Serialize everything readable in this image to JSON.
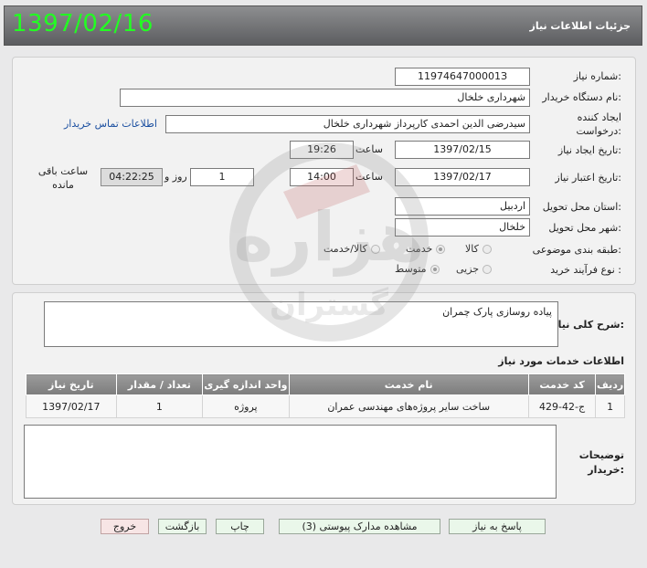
{
  "header": {
    "date": "1397/02/16",
    "title": "جزئیات اطلاعات نیاز"
  },
  "form": {
    "need_number_label": "شماره نیاز:",
    "need_number": "1197464700001З",
    "buyer_org_label": "نام دستگاه خریدار:",
    "buyer_org": "شهرداری خلخال",
    "creator_label": "ایجاد کننده درخواست:",
    "creator": "سیدرضی الدین  احمدی کارپرداز شهرداری خلخال",
    "contact_link": "اطلاعات تماس خریدار",
    "created_label": "تاریخ ایجاد نیاز:",
    "created_date": "1397/02/15",
    "time_label": "ساعت",
    "created_time": "19:26",
    "validity_label": "تاریخ اعتبار نیاز:",
    "validity_date": "1397/02/17",
    "validity_time": "14:00",
    "days": "1",
    "days_label": "روز و",
    "countdown": "04:22:25",
    "remaining_label": "ساعت باقی مانده",
    "province_label": "استان محل تحویل:",
    "province": "اردبیل",
    "city_label": "شهر محل تحویل:",
    "city": "خلخال",
    "category_label": "طبقه بندی موضوعی:",
    "category_options": [
      "کالا",
      "خدمت",
      "کالا/خدمت"
    ],
    "process_label": "نوع فرآیند خرید :",
    "process_options": [
      "جزیی",
      "متوسط"
    ]
  },
  "details": {
    "summary_label": "شرح کلی نیاز:",
    "summary": "پیاده روسازی پارک چمران",
    "services_title": "اطلاعات خدمات مورد نیاز",
    "columns": [
      "ردیف",
      "کد خدمت",
      "نام خدمت",
      "واحد اندازه گیری",
      "تعداد / مقدار",
      "تاریخ نیاز"
    ],
    "rows": [
      [
        "1",
        "ج-42-429",
        "ساخت سایر پروژه‌های مهندسی عمران",
        "پروژه",
        "1",
        "1397/02/17"
      ]
    ],
    "notes_label": "توضیحات خریدار:"
  },
  "buttons": {
    "reply": "پاسخ به نیاز",
    "attachments": "مشاهده مدارک پیوستی (3)",
    "print": "چاپ",
    "back": "بازگشت",
    "exit": "خروج"
  },
  "watermark": {
    "main": "هزاره",
    "sub": "گستران"
  }
}
